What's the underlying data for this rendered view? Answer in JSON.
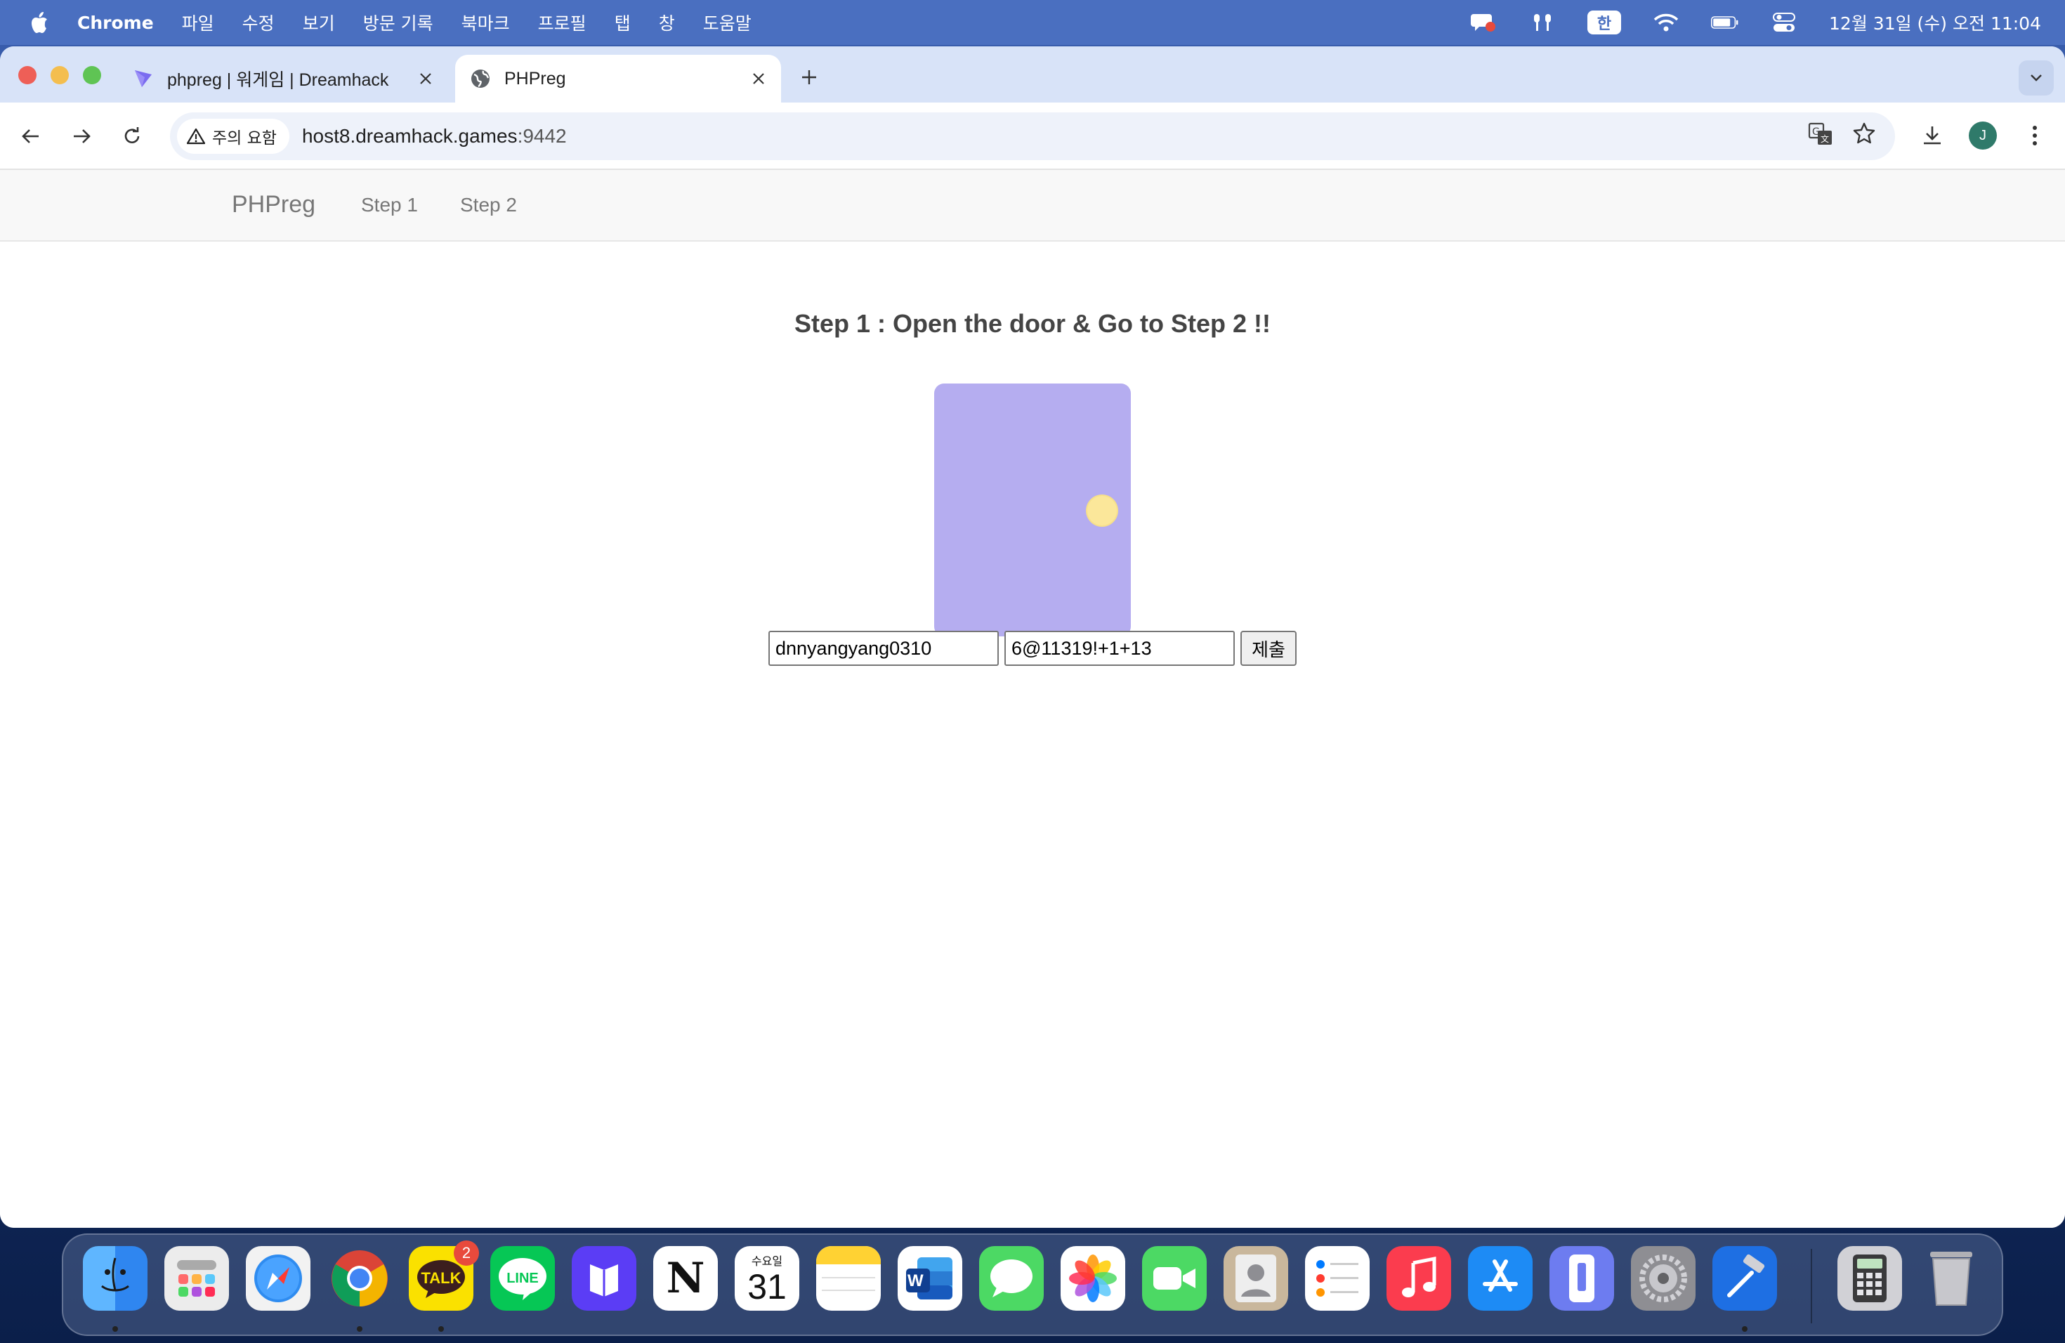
{
  "menubar": {
    "app_name": "Chrome",
    "menu_items": [
      "파일",
      "수정",
      "보기",
      "방문 기록",
      "북마크",
      "프로필",
      "탭",
      "창",
      "도움말"
    ],
    "ime_label": "한",
    "clock": "12월 31일 (수) 오전 11:04"
  },
  "browser": {
    "tabs": [
      {
        "title": "phpreg | 워게임 | Dreamhack",
        "favicon": "dreamhack-icon",
        "active": false
      },
      {
        "title": "PHPreg",
        "favicon": "globe-icon",
        "active": true
      }
    ],
    "security_label": "주의 요함",
    "url_host": "host8.dreamhack.games",
    "url_port": ":9442",
    "profile_initial": "J"
  },
  "page": {
    "brand": "PHPreg",
    "nav_links": [
      "Step 1",
      "Step 2"
    ],
    "heading": "Step 1 : Open the door & Go to Step 2 !!",
    "form": {
      "input1_value": "dnnyangyang0310",
      "input2_value": "6@11319!+1+13",
      "submit_label": "제출"
    }
  },
  "colors": {
    "door": "#b5adf0",
    "door_knob": "#fbe79a",
    "menubar": "#4a6fc0",
    "tabstrip": "#d8e3f8"
  },
  "dock": {
    "apps": [
      {
        "name": "finder-icon",
        "running": true
      },
      {
        "name": "launchpad-icon",
        "running": false
      },
      {
        "name": "safari-icon",
        "running": false
      },
      {
        "name": "chrome-icon",
        "running": true
      },
      {
        "name": "kakaotalk-icon",
        "label": "TALK",
        "badge": "2",
        "running": true
      },
      {
        "name": "line-icon",
        "label": "LINE",
        "running": false
      },
      {
        "name": "bookmark-app-icon",
        "running": false
      },
      {
        "name": "notion-icon",
        "label": "N",
        "running": false
      },
      {
        "name": "calendar-icon",
        "weekday": "수요일",
        "day": "31",
        "running": false
      },
      {
        "name": "notes-icon",
        "running": false
      },
      {
        "name": "word-icon",
        "label": "W",
        "running": false
      },
      {
        "name": "messages-icon",
        "running": false
      },
      {
        "name": "photos-icon",
        "running": false
      },
      {
        "name": "facetime-icon",
        "running": false
      },
      {
        "name": "contacts-icon",
        "running": false
      },
      {
        "name": "reminders-icon",
        "running": false
      },
      {
        "name": "music-icon",
        "running": false
      },
      {
        "name": "app-store-icon",
        "running": false
      },
      {
        "name": "iphone-mirroring-icon",
        "running": false
      },
      {
        "name": "system-settings-icon",
        "running": false
      },
      {
        "name": "xcode-icon",
        "running": true
      },
      {
        "name": "calculator-icon",
        "running": false
      },
      {
        "name": "trash-icon",
        "running": false
      }
    ]
  }
}
